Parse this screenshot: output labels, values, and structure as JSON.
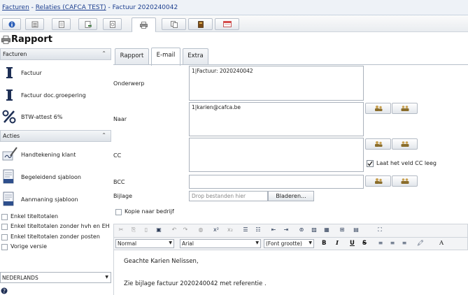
{
  "breadcrumb": {
    "part1": "Facturen",
    "sep1": " - ",
    "part2": "Relaties (CAFCA TEST)",
    "sep2": " - ",
    "part3": "Factuur 2020240042"
  },
  "toolbar": {
    "buttons": [
      {
        "icon": "info-icon"
      },
      {
        "icon": "list-icon"
      },
      {
        "icon": "document-icon"
      },
      {
        "icon": "document-arrow-icon"
      },
      {
        "icon": "document-lines-icon"
      },
      {
        "icon": "printer-icon"
      },
      {
        "icon": "copy-icon"
      },
      {
        "icon": "book-icon"
      },
      {
        "icon": "window-icon"
      }
    ]
  },
  "page": {
    "title": "Rapport",
    "title_icon": "printer-icon"
  },
  "sidebar": {
    "facturen_label": "Facturen",
    "facturen_items": [
      {
        "label": "Factuur",
        "icon": "invoice-icon"
      },
      {
        "label": "Factuur doc.groepering",
        "icon": "invoice-icon"
      },
      {
        "label": "BTW-attest 6%",
        "icon": "percent-icon"
      }
    ],
    "acties_label": "Acties",
    "acties_items": [
      {
        "label": "Handtekening klant",
        "icon": "signature-icon"
      },
      {
        "label": "Begeleidend sjabloon",
        "icon": "template-icon"
      },
      {
        "label": "Aanmaning sjabloon",
        "icon": "template-icon"
      }
    ],
    "options": [
      {
        "label": "Enkel titeltotalen",
        "checked": false
      },
      {
        "label": "Enkel titeltotalen zonder hvh en EH",
        "checked": false
      },
      {
        "label": "Enkel titeltotalen zonder posten",
        "checked": false
      },
      {
        "label": "Vorige versie",
        "checked": false
      }
    ],
    "language": "NEDERLANDS",
    "help_icon": "help-icon"
  },
  "tabs": [
    {
      "label": "Rapport",
      "active": false
    },
    {
      "label": "E-mail",
      "active": true
    },
    {
      "label": "Extra",
      "active": false
    }
  ],
  "form": {
    "subject_label": "Onderwerp",
    "subject_value": "1|Factuur: 2020240042",
    "to_label": "Naar",
    "to_value": "1|karien@cafca.be",
    "cc_label": "CC",
    "cc_value": "",
    "cc_empty_label": "Laat het veld CC leeg",
    "cc_empty_checked": true,
    "bcc_label": "BCC",
    "bcc_value": "",
    "attachment_label": "Bijlage",
    "attachment_placeholder": "Drop bestanden hier",
    "browse_label": "Bladeren...",
    "copy_company_label": "Kopie naar bedrijf",
    "copy_company_checked": false
  },
  "editor": {
    "format_value": "Normal",
    "font_value": "Arial",
    "size_value": "(Font grootte)",
    "bold": "B",
    "italic": "I",
    "underline": "U",
    "strike": "S",
    "color_a": "A",
    "body_line1": "Geachte Karien Nelissen,",
    "body_line2": "Zie bijlage factuur 2020240042 met referentie ."
  }
}
